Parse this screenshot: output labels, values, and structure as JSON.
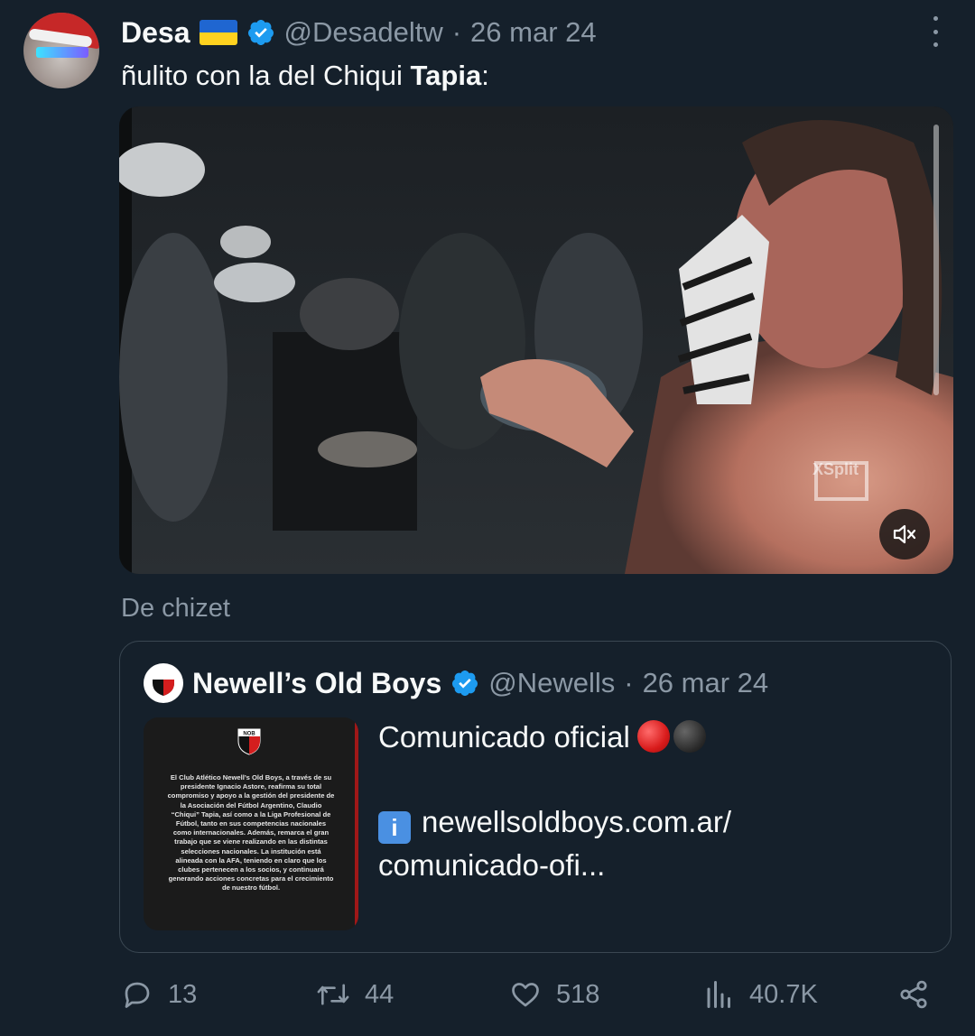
{
  "tweet": {
    "author_name": "Desa",
    "author_handle": "@Desadeltw",
    "separator": "·",
    "date": "26 mar 24",
    "text_prefix": "ñulito con la del Chiqui ",
    "text_bold": "Tapia",
    "text_suffix": ":"
  },
  "video": {
    "watermark": "XSplit",
    "mute_icon": "speaker-muted-icon"
  },
  "source_label": "De chizet",
  "quote": {
    "author_name": "Newell’s Old Boys",
    "author_handle": "@Newells",
    "separator": "·",
    "date": "26 mar 24",
    "text_line1": "Comunicado oficial",
    "link_line1": "newellsoldboys.com.ar/",
    "link_line2": "comunicado-ofi...",
    "image_crest_text": "NOB",
    "image_body": "El Club Atlético Newell’s Old Boys, a través de su presidente Ignacio Astore, reafirma su total compromiso y apoyo a la gestión del presidente de la Asociación del Fútbol Argentino, Claudio “Chiqui” Tapia, así como a la Liga Profesional de Fútbol, tanto en sus competencias nacionales como internacionales. Además, remarca el gran trabajo que se viene realizando en las distintas selecciones nacionales. La institución está alineada con la AFA, teniendo en claro que los clubes pertenecen a los socios, y continuará generando acciones concretas para el crecimiento de nuestro fútbol."
  },
  "actions": {
    "replies": "13",
    "retweets": "44",
    "likes": "518",
    "views": "40.7K"
  },
  "colors": {
    "background": "#15202b",
    "secondary_text": "#8b98a5",
    "verified_blue": "#1d9bf0"
  }
}
